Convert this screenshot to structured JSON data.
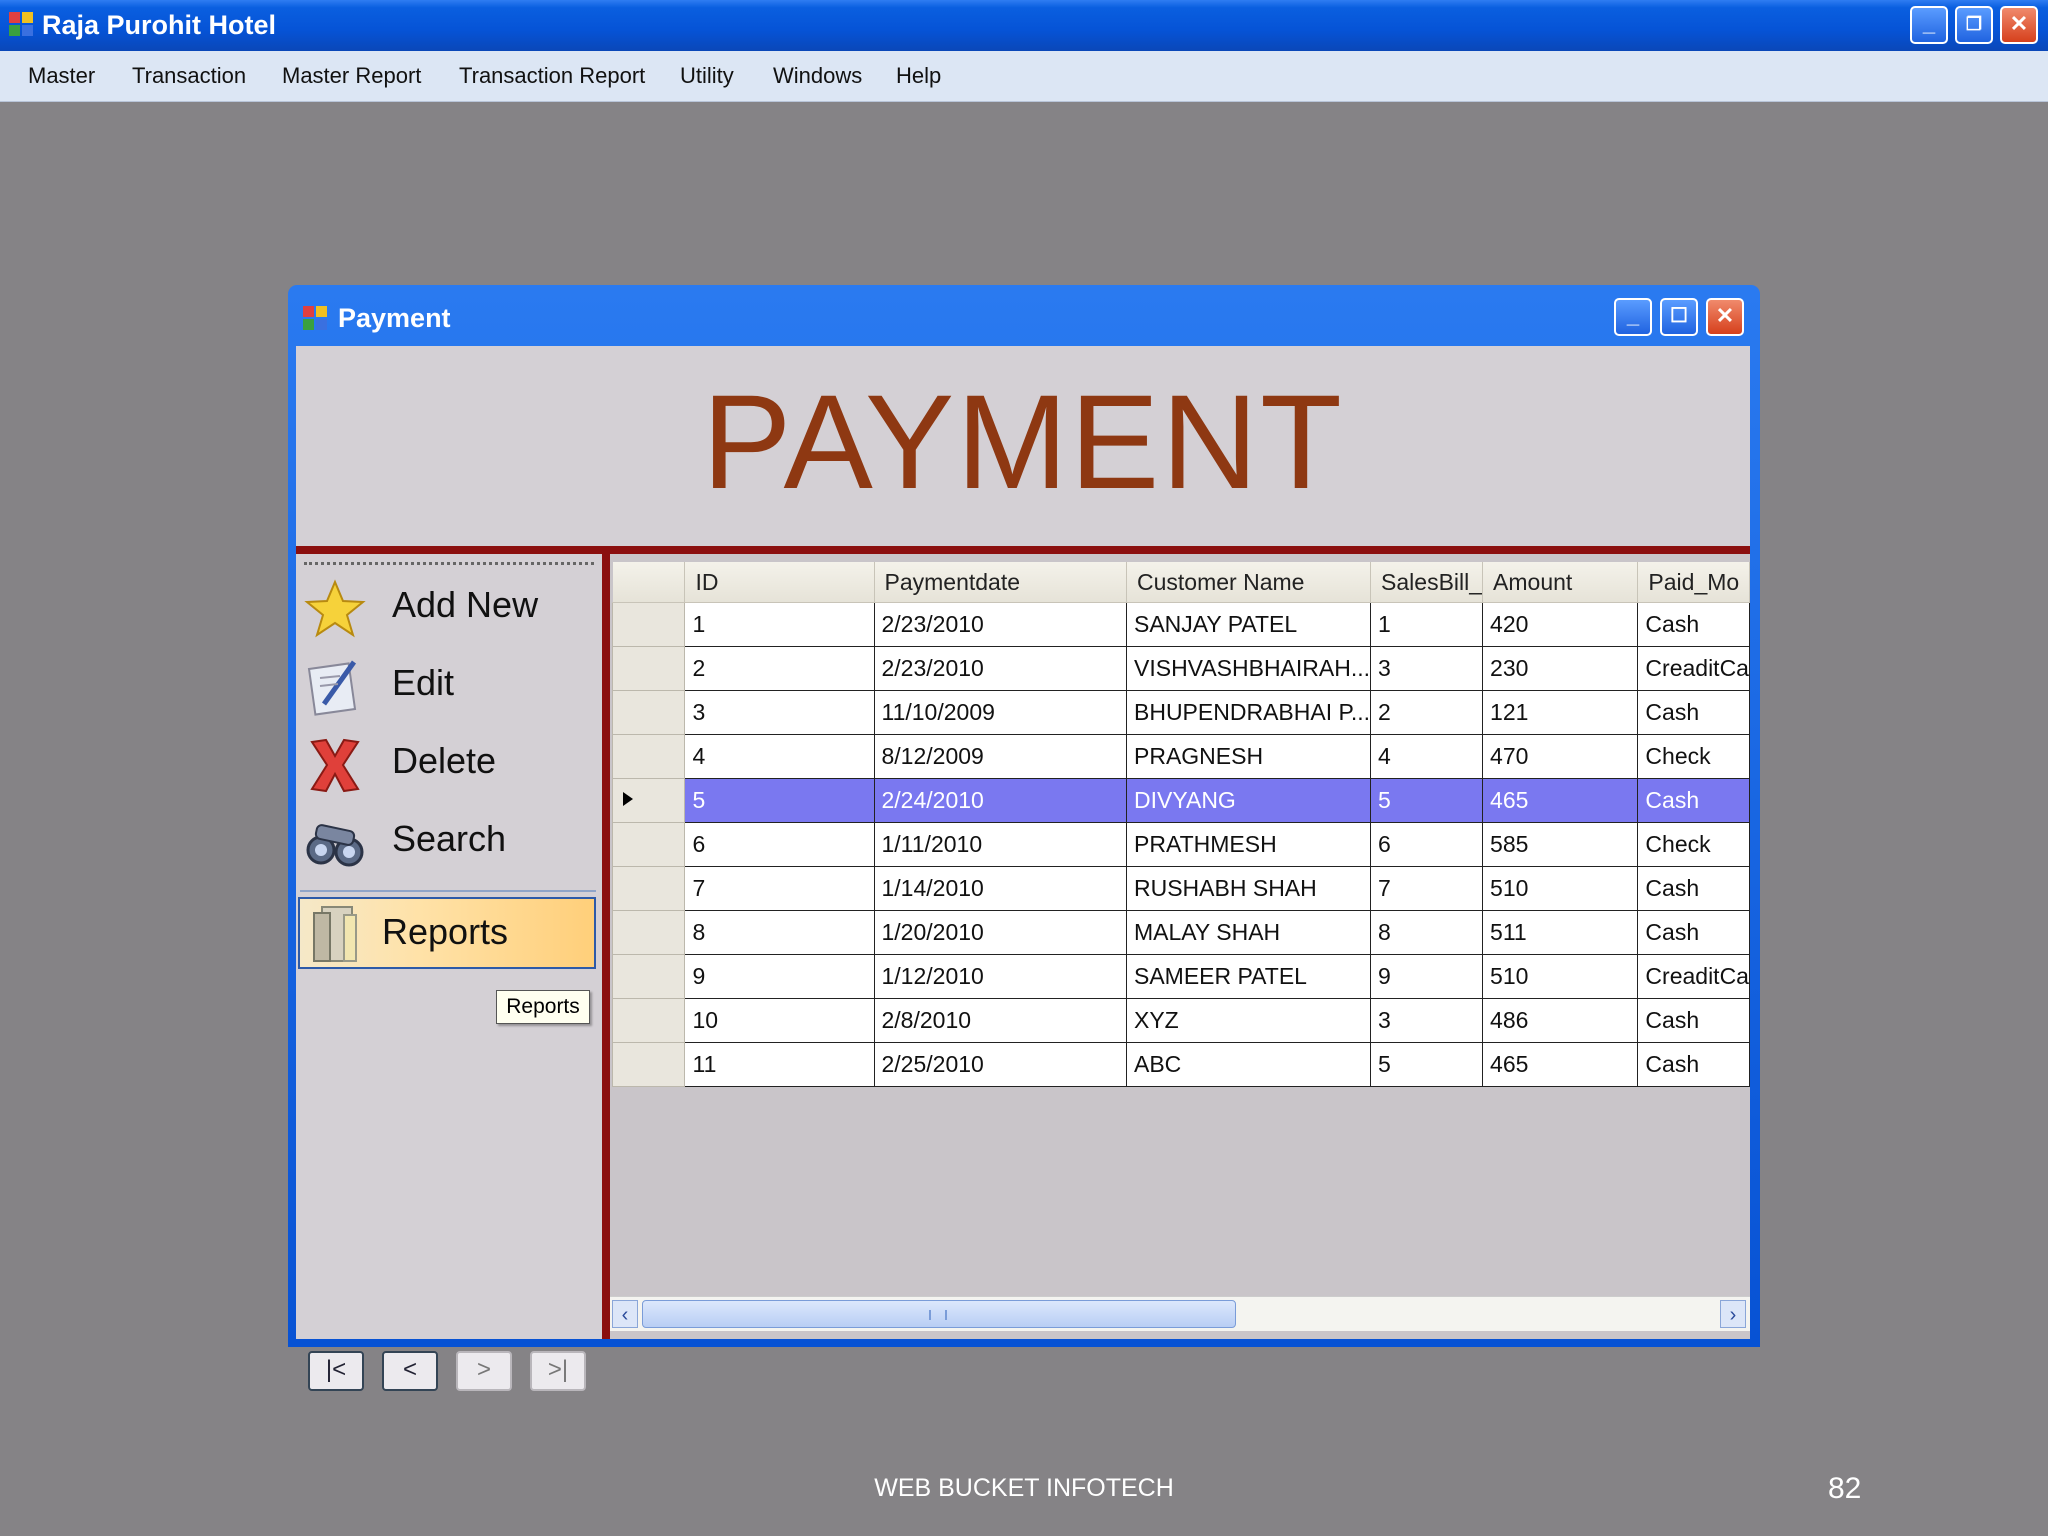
{
  "app": {
    "title": "Raja Purohit Hotel",
    "menu": [
      "Master",
      "Transaction",
      "Master Report",
      "Transaction Report",
      "Utility",
      "Windows",
      "Help"
    ]
  },
  "child_window": {
    "title": "Payment",
    "heading": "PAYMENT"
  },
  "actions": {
    "add_new": "Add New",
    "edit": "Edit",
    "delete": "Delete",
    "search": "Search",
    "reports": "Reports",
    "tooltip": "Reports"
  },
  "navigation": [
    "|<",
    "<",
    ">",
    ">|"
  ],
  "grid": {
    "columns": [
      "ID",
      "Paymentdate",
      "Customer Name",
      "SalesBill_",
      "Amount",
      "Paid_Mo"
    ],
    "selected_row": 4,
    "rows": [
      [
        "1",
        "2/23/2010",
        "SANJAY PATEL",
        "1",
        "420",
        "Cash"
      ],
      [
        "2",
        "2/23/2010",
        "VISHVASHBHAIRAH...",
        "3",
        "230",
        "CreaditCa"
      ],
      [
        "3",
        "11/10/2009",
        "BHUPENDRABHAI P...",
        "2",
        "121",
        "Cash"
      ],
      [
        "4",
        "8/12/2009",
        "PRAGNESH",
        "4",
        "470",
        "Check"
      ],
      [
        "5",
        "2/24/2010",
        "DIVYANG",
        "5",
        "465",
        "Cash"
      ],
      [
        "6",
        "1/11/2010",
        "PRATHMESH",
        "6",
        "585",
        "Check"
      ],
      [
        "7",
        "1/14/2010",
        "RUSHABH SHAH",
        "7",
        "510",
        "Cash"
      ],
      [
        "8",
        "1/20/2010",
        "MALAY SHAH",
        "8",
        "511",
        "Cash"
      ],
      [
        "9",
        "1/12/2010",
        "SAMEER PATEL",
        "9",
        "510",
        "CreaditCa"
      ],
      [
        "10",
        "2/8/2010",
        "XYZ",
        "3",
        "486",
        "Cash"
      ],
      [
        "11",
        "2/25/2010",
        "ABC",
        "5",
        "465",
        "Cash"
      ]
    ]
  },
  "footer": {
    "text": "WEB BUCKET INFOTECH",
    "page_number": "82"
  },
  "colors": {
    "titlebar": "#0653d6",
    "heading": "#8e3812",
    "divider": "#8b0f0f",
    "selection": "#7a78f0"
  }
}
